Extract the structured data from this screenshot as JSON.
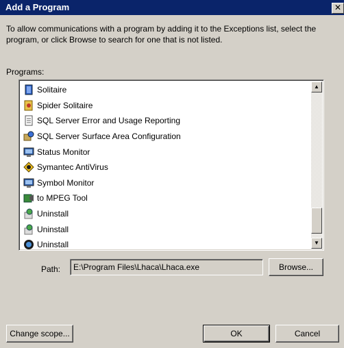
{
  "dialog": {
    "title": "Add a Program",
    "close_glyph": "✕",
    "description": "To allow communications with a program by adding it to the Exceptions list, select the program, or click Browse to search for one that is not listed.",
    "programs_label": "Programs:"
  },
  "programs": [
    {
      "label": "Solitaire",
      "icon": "solitaire-icon"
    },
    {
      "label": "Spider Solitaire",
      "icon": "spider-solitaire-icon"
    },
    {
      "label": "SQL Server Error and Usage Reporting",
      "icon": "document-icon"
    },
    {
      "label": "SQL Server Surface Area Configuration",
      "icon": "sql-config-icon"
    },
    {
      "label": "Status Monitor",
      "icon": "monitor-icon"
    },
    {
      "label": "Symantec AntiVirus",
      "icon": "antivirus-icon"
    },
    {
      "label": "Symbol Monitor",
      "icon": "monitor-icon"
    },
    {
      "label": "to MPEG Tool",
      "icon": "mpeg-tool-icon"
    },
    {
      "label": "Uninstall",
      "icon": "uninstall-icon"
    },
    {
      "label": "Uninstall",
      "icon": "uninstall-icon"
    },
    {
      "label": "Uninstall",
      "icon": "uninstall-globe-icon"
    }
  ],
  "path": {
    "label": "Path:",
    "value": "E:\\Program Files\\Lhaca\\Lhaca.exe"
  },
  "buttons": {
    "browse": "Browse...",
    "change_scope": "Change scope...",
    "ok": "OK",
    "cancel": "Cancel"
  },
  "scrollbar": {
    "up_glyph": "▲",
    "down_glyph": "▼"
  },
  "colors": {
    "titlebar": "#0a246a",
    "face": "#d4d0c8"
  }
}
